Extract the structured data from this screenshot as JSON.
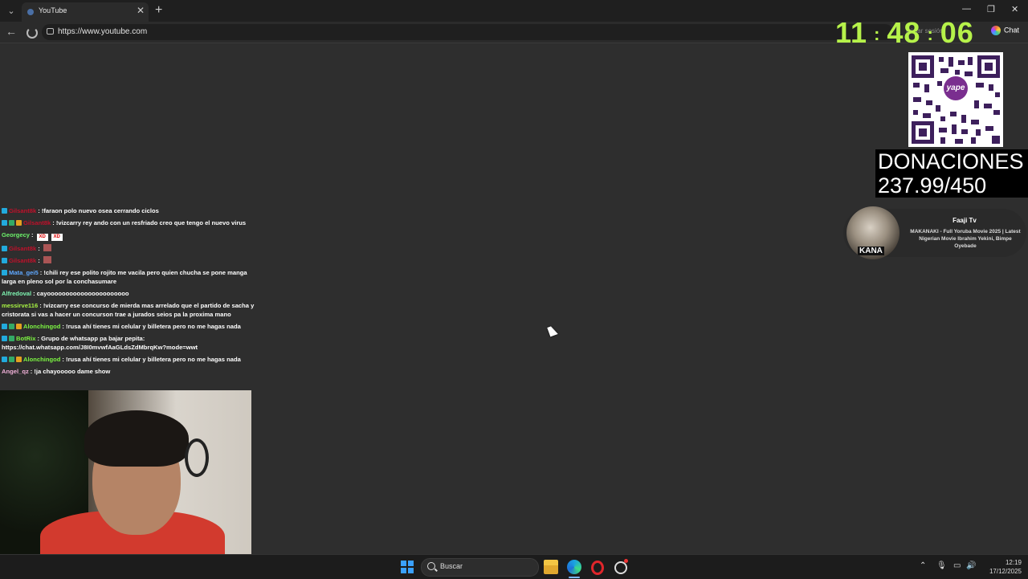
{
  "browser": {
    "tab_title": "YouTube",
    "tab_close": "✕",
    "new_tab": "+",
    "url": "https://www.youtube.com",
    "signin_label": "Iniciar sesión",
    "chat_label": "Chat",
    "back_glyph": "←",
    "window_controls": {
      "minimize": "—",
      "restore": "❐",
      "close": "✕"
    }
  },
  "clock": {
    "hours": "11",
    "minutes": "48",
    "seconds": "06",
    "separator": ":"
  },
  "qr": {
    "brand": "yape"
  },
  "donations": {
    "label": "DONACIONES",
    "value": "237.99/450"
  },
  "now_playing": {
    "channel": "Faaji Tv",
    "title": "MAKANAKI - Full Yoruba Movie 2025 | Latest Nigerian Movie Ibrahim Yekini, Bimpe Oyebade",
    "thumb_text": "KANA"
  },
  "chat": {
    "messages": [
      {
        "user": "Gilsant8k",
        "user_color": "#c0102a",
        "badges": [
          "sub"
        ],
        "text": "!faraon polo nuevo osea cerrando ciclos"
      },
      {
        "user": "Gilsant8k",
        "user_color": "#c0102a",
        "badges": [
          "sub",
          "mod",
          "crown"
        ],
        "text": "!vizcarry rey ando con un resfriado creo que tengo el nuevo virus"
      },
      {
        "user": "Georgecy",
        "user_color": "#6cf26a",
        "badges": [],
        "text": "",
        "emotes": [
          "XD",
          "XD"
        ]
      },
      {
        "user": "Gilsant8k",
        "user_color": "#c0102a",
        "badges": [
          "sub"
        ],
        "text": "",
        "emote_img": true
      },
      {
        "user": "Gilsant8k",
        "user_color": "#c0102a",
        "badges": [
          "sub"
        ],
        "text": "",
        "emote_img": true
      },
      {
        "user": "Mata_gei5",
        "user_color": "#5fa8ff",
        "badges": [
          "sub"
        ],
        "text": "!chili rey ese polito rojito me vacila pero quien chucha se pone manga larga en pleno sol por la conchasumare"
      },
      {
        "user": "Alfredoval",
        "user_color": "#7ff5b2",
        "badges": [],
        "text": "cayoooooooooooooooooooooo"
      },
      {
        "user": "messirve116",
        "user_color": "#a6f043",
        "badges": [],
        "text": "!vizcarry ese concurso de mierda mas arrelado que el partido de sacha y cristorata si vas a hacer un concurson trae a jurados seios pa la proxima mano"
      },
      {
        "user": "Alonchingod",
        "user_color": "#7cf542",
        "badges": [
          "sub",
          "mod",
          "crown"
        ],
        "text": "!rusa ahí tienes mi celular y billetera pero no me hagas nada"
      },
      {
        "user": "BotRix",
        "user_color": "#7cf542",
        "badges": [
          "sub",
          "mod"
        ],
        "text": "Grupo de whatsapp pa bajar pepita: https://chat.whatsapp.com/J8I0mvwfAaGLdsZdMbrqKw?mode=wwt"
      },
      {
        "user": "Alonchingod",
        "user_color": "#7cf542",
        "badges": [
          "sub",
          "mod",
          "crown"
        ],
        "text": "!rusa ahí tienes mi celular y billetera pero no me hagas nada"
      },
      {
        "user": "Angel_qz",
        "user_color": "#f0b0d8",
        "badges": [],
        "text": "!ja chayooooo dame show"
      }
    ]
  },
  "taskbar": {
    "search_placeholder": "Buscar",
    "time": "12:19",
    "date": "17/12/2025",
    "tray_chevron": "⌃",
    "tray_mic": "🎙",
    "tray_display": "▭",
    "tray_volume": "🔊"
  }
}
